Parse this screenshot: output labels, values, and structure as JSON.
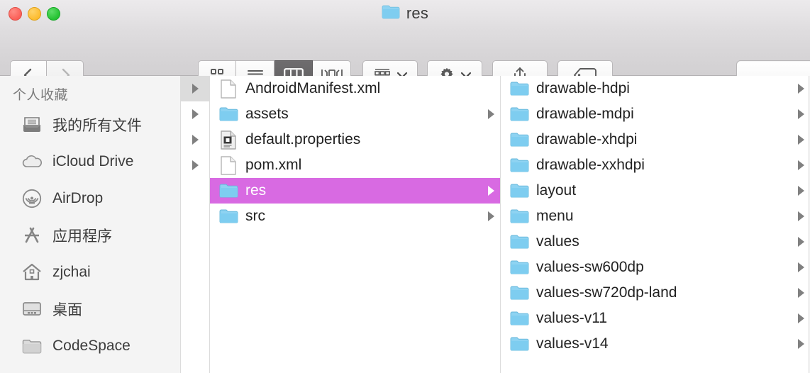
{
  "window": {
    "title": "res",
    "title_icon": "blue-folder-icon",
    "traffic_lights": [
      {
        "name": "close",
        "color": "#fb6058"
      },
      {
        "name": "minimize",
        "color": "#fdbc2f"
      },
      {
        "name": "zoom",
        "color": "#25c232"
      }
    ]
  },
  "toolbar": {
    "back_label": "",
    "forward_label": "",
    "view_modes": [
      {
        "name": "icon-view",
        "active": false
      },
      {
        "name": "list-view",
        "active": false
      },
      {
        "name": "column-view",
        "active": true
      },
      {
        "name": "coverflow-view",
        "active": false
      }
    ],
    "arrange_label": "",
    "action_label": "",
    "share_label": "",
    "tag_label": "",
    "search_placeholder": ""
  },
  "sidebar": {
    "header": "个人收藏",
    "items": [
      {
        "label": "我的所有文件",
        "icon": "all-files-icon"
      },
      {
        "label": "iCloud Drive",
        "icon": "cloud-icon"
      },
      {
        "label": "AirDrop",
        "icon": "airdrop-icon"
      },
      {
        "label": "应用程序",
        "icon": "applications-icon"
      },
      {
        "label": "zjchai",
        "icon": "home-icon"
      },
      {
        "label": "桌面",
        "icon": "desktop-icon"
      },
      {
        "label": "CodeSpace",
        "icon": "folder-icon"
      }
    ]
  },
  "columns": {
    "stub": {
      "rows": [
        {
          "has_arrow": true,
          "selected": true
        },
        {
          "has_arrow": true,
          "selected": false
        },
        {
          "has_arrow": true,
          "selected": false
        },
        {
          "has_arrow": true,
          "selected": false
        },
        {
          "has_arrow": false,
          "selected": false
        },
        {
          "has_arrow": false,
          "selected": false
        }
      ]
    },
    "project": {
      "rows": [
        {
          "label": "AndroidManifest.xml",
          "icon": "document-icon",
          "has_arrow": false,
          "selected": false
        },
        {
          "label": "assets",
          "icon": "folder-icon",
          "has_arrow": true,
          "selected": false
        },
        {
          "label": "default.properties",
          "icon": "java-properties-icon",
          "has_arrow": false,
          "selected": false
        },
        {
          "label": "pom.xml",
          "icon": "document-icon",
          "has_arrow": false,
          "selected": false
        },
        {
          "label": "res",
          "icon": "folder-icon",
          "has_arrow": true,
          "selected": true
        },
        {
          "label": "src",
          "icon": "folder-icon",
          "has_arrow": true,
          "selected": false
        }
      ]
    },
    "res": {
      "rows": [
        {
          "label": "drawable-hdpi",
          "icon": "folder-icon",
          "has_arrow": true,
          "selected": false
        },
        {
          "label": "drawable-mdpi",
          "icon": "folder-icon",
          "has_arrow": true,
          "selected": false
        },
        {
          "label": "drawable-xhdpi",
          "icon": "folder-icon",
          "has_arrow": true,
          "selected": false
        },
        {
          "label": "drawable-xxhdpi",
          "icon": "folder-icon",
          "has_arrow": true,
          "selected": false
        },
        {
          "label": "layout",
          "icon": "folder-icon",
          "has_arrow": true,
          "selected": false
        },
        {
          "label": "menu",
          "icon": "folder-icon",
          "has_arrow": true,
          "selected": false
        },
        {
          "label": "values",
          "icon": "folder-icon",
          "has_arrow": true,
          "selected": false
        },
        {
          "label": "values-sw600dp",
          "icon": "folder-icon",
          "has_arrow": true,
          "selected": false
        },
        {
          "label": "values-sw720dp-land",
          "icon": "folder-icon",
          "has_arrow": true,
          "selected": false
        },
        {
          "label": "values-v11",
          "icon": "folder-icon",
          "has_arrow": true,
          "selected": false
        },
        {
          "label": "values-v14",
          "icon": "folder-icon",
          "has_arrow": true,
          "selected": false
        }
      ]
    }
  },
  "colors": {
    "selection": "#d86ae2",
    "inactive_selection": "#dcdcdc",
    "folder_blue": "#7ed0f0",
    "toolbar_active": "#666666"
  }
}
